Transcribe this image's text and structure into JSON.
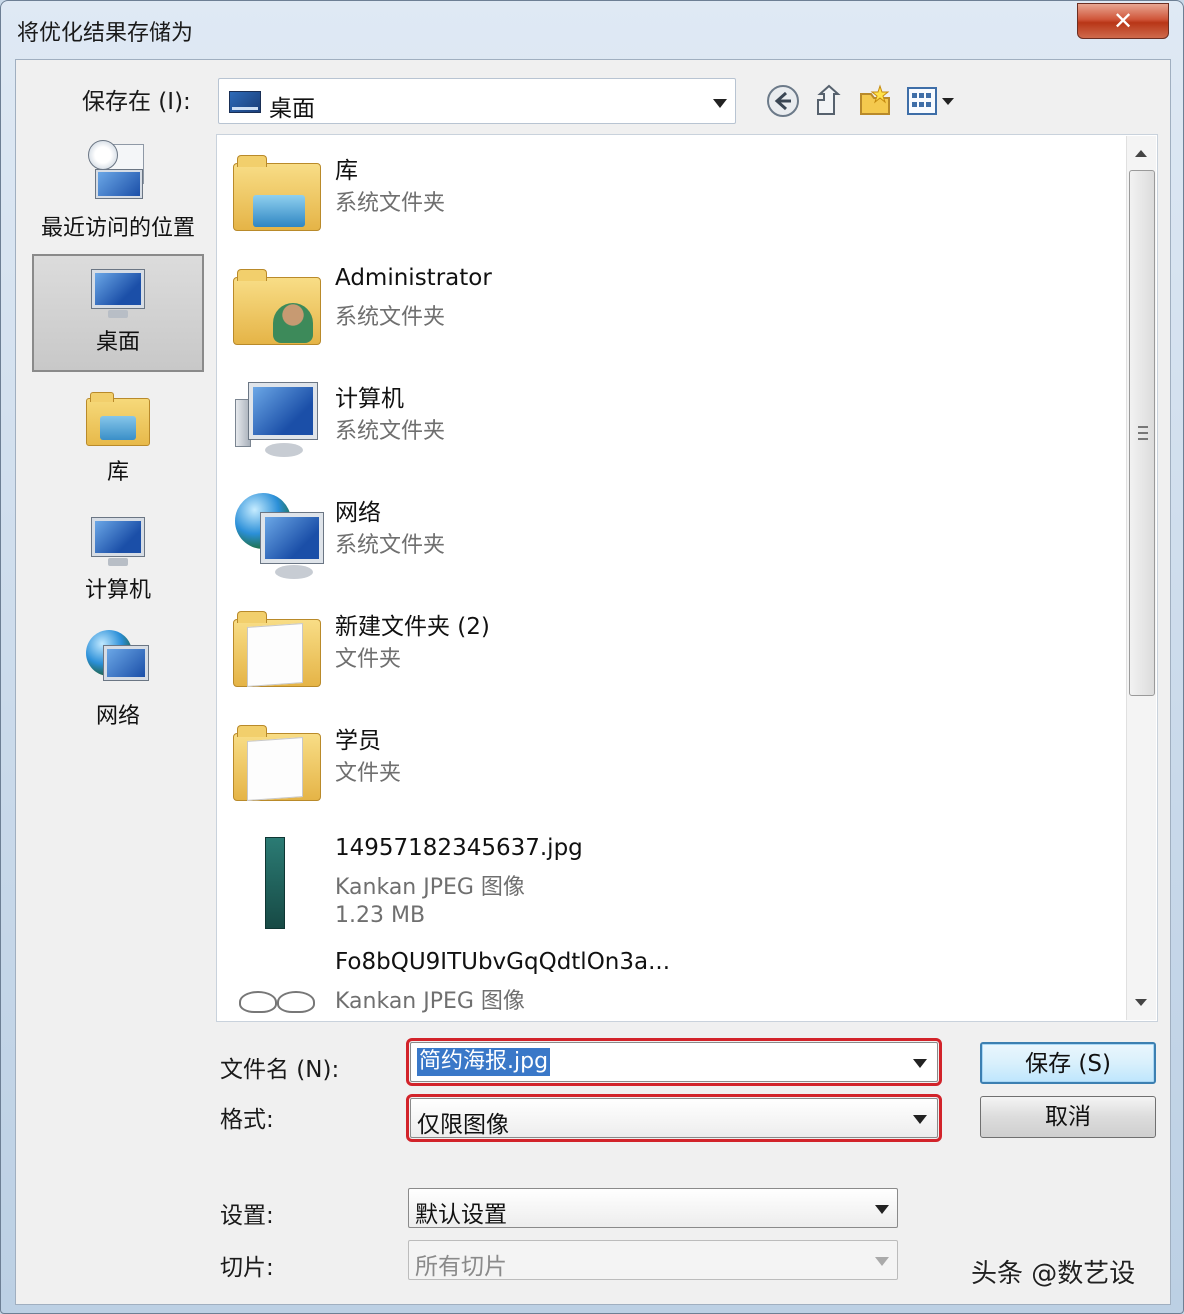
{
  "window": {
    "title": "将优化结果存储为",
    "close_label": "✕"
  },
  "toolbar": {
    "save_in_label": "保存在 (I):",
    "location": "桌面",
    "icons": [
      "back-icon",
      "up-folder-icon",
      "new-folder-icon",
      "view-menu-icon"
    ]
  },
  "places": [
    {
      "label": "最近访问的位置",
      "icon": "recent-places-icon"
    },
    {
      "label": "桌面",
      "icon": "desktop-icon",
      "selected": true
    },
    {
      "label": "库",
      "icon": "libraries-icon"
    },
    {
      "label": "计算机",
      "icon": "computer-icon"
    },
    {
      "label": "网络",
      "icon": "network-icon"
    }
  ],
  "files": [
    {
      "name": "库",
      "type": "系统文件夹",
      "icon": "libraries-folder-icon"
    },
    {
      "name": "Administrator",
      "type": "系统文件夹",
      "icon": "user-folder-icon"
    },
    {
      "name": "计算机",
      "type": "系统文件夹",
      "icon": "computer-icon"
    },
    {
      "name": "网络",
      "type": "系统文件夹",
      "icon": "network-icon"
    },
    {
      "name": "新建文件夹 (2)",
      "type": "文件夹",
      "icon": "folder-icon"
    },
    {
      "name": "学员",
      "type": "文件夹",
      "icon": "folder-icon"
    },
    {
      "name": "14957182345637.jpg",
      "type": "Kankan JPEG 图像",
      "size": "1.23 MB",
      "icon": "jpg-thumbnail-icon"
    },
    {
      "name": "Fo8bQU9ITUbvGqQdtlOn3a...",
      "type": "Kankan JPEG 图像",
      "icon": "jpg-thumbnail-icon"
    }
  ],
  "form": {
    "filename_label": "文件名 (N):",
    "filename_value": "简约海报.jpg",
    "format_label": "格式:",
    "format_value": "仅限图像",
    "settings_label": "设置:",
    "settings_value": "默认设置",
    "slices_label": "切片:",
    "slices_value": "所有切片"
  },
  "buttons": {
    "save": "保存 (S)",
    "cancel": "取消"
  },
  "watermark": "头条 @数艺设",
  "colors": {
    "highlight_box": "#d2232a",
    "selection": "#3a78c8",
    "close_button": "#c8452a"
  }
}
